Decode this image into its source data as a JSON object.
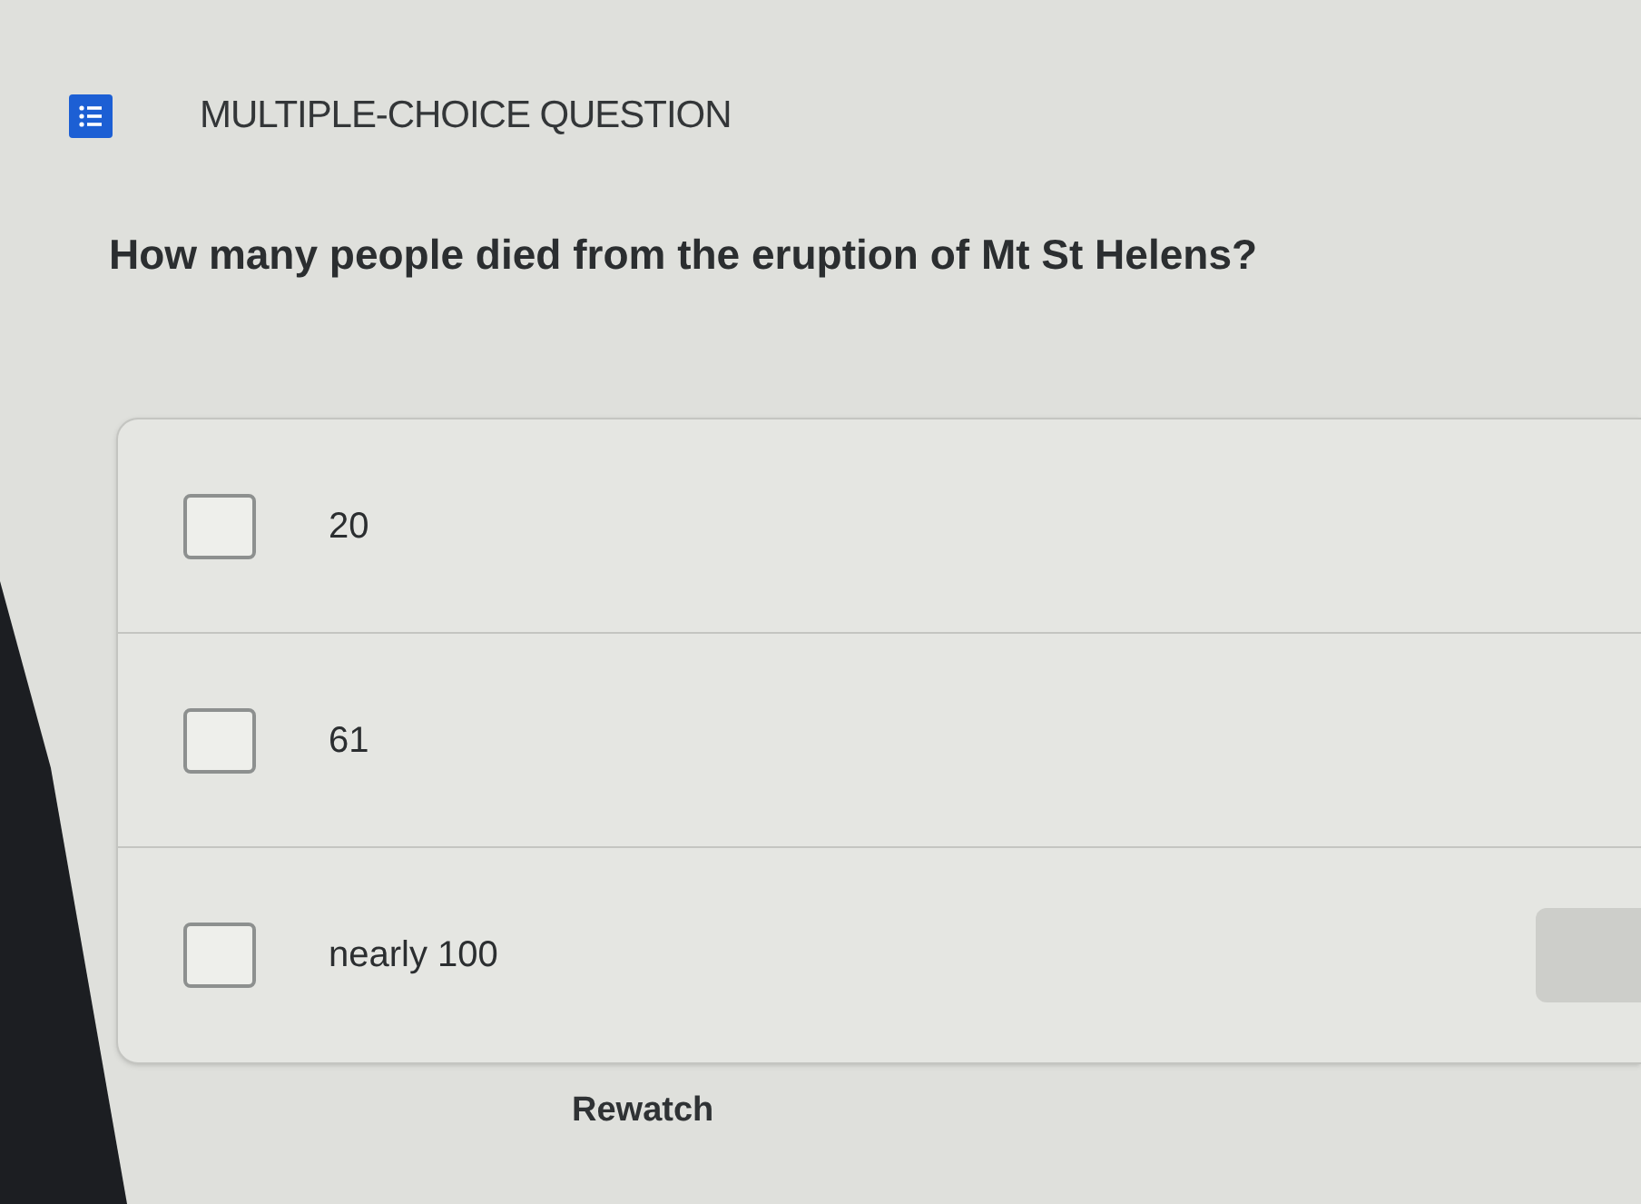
{
  "header": {
    "title": "MULTIPLE-CHOICE QUESTION"
  },
  "question": "How many people died from the eruption of Mt St Helens?",
  "options": [
    {
      "label": "20",
      "checked": false
    },
    {
      "label": "61",
      "checked": false
    },
    {
      "label": "nearly 100",
      "checked": false
    }
  ],
  "rewatch": {
    "label": "Rewatch"
  }
}
